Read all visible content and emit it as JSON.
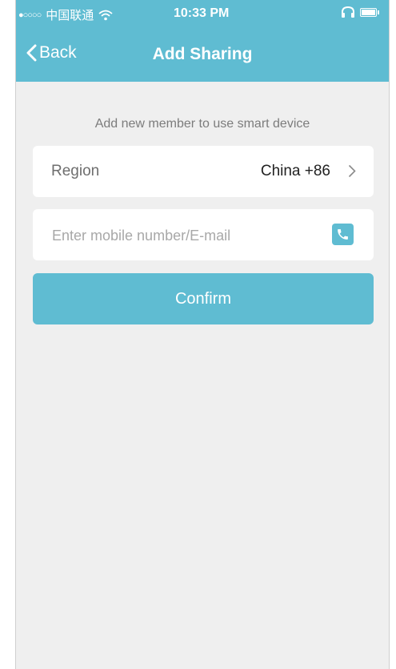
{
  "status_bar": {
    "signal": "●○○○○",
    "carrier": "中国联通",
    "time": "10:33 PM",
    "icons": [
      "wifi-icon",
      "headphone-icon",
      "battery-icon"
    ]
  },
  "nav": {
    "back_label": "Back",
    "title": "Add Sharing"
  },
  "form": {
    "hint": "Add new member to use smart device",
    "region_label": "Region",
    "region_value": "China +86",
    "input_placeholder": "Enter mobile number/E-mail",
    "input_value": "",
    "confirm_label": "Confirm"
  },
  "colors": {
    "accent": "#5fbcd2",
    "background": "#efefef",
    "card": "#ffffff"
  }
}
